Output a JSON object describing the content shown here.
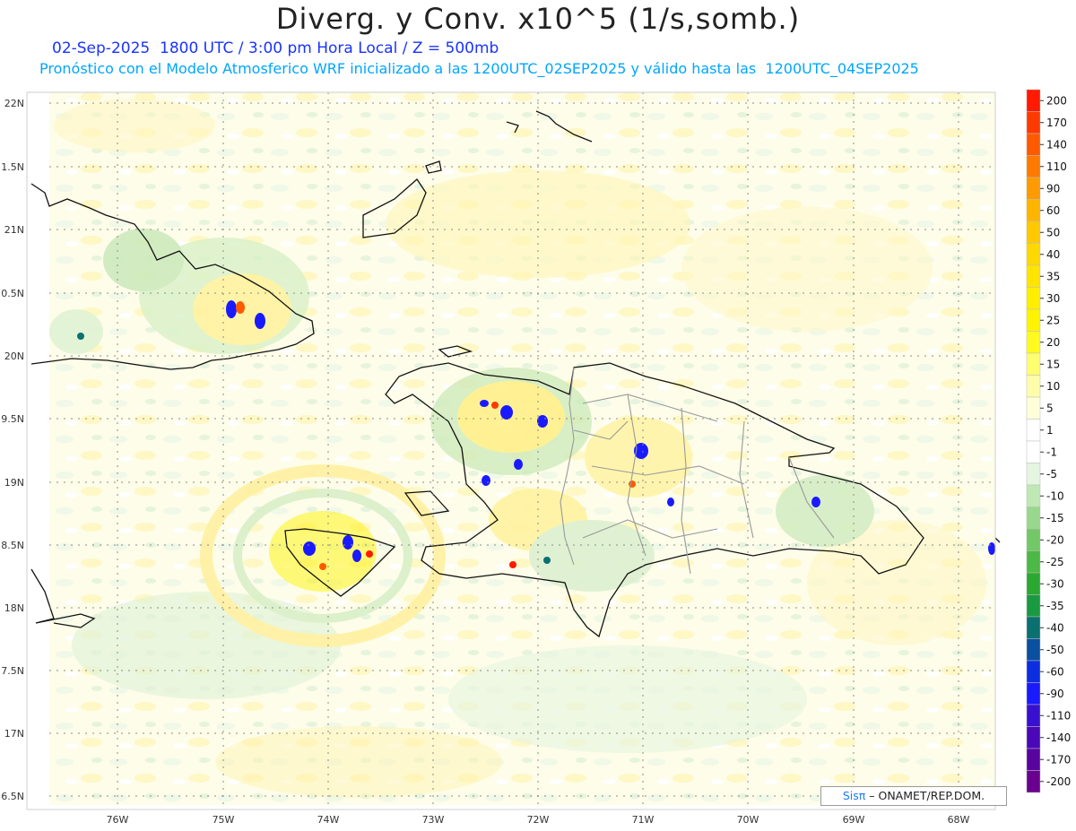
{
  "header": {
    "title": "Diverg. y Conv. x10^5 (1/s,somb.)",
    "subtitle_line1": "02-Sep-2025  1800 UTC / 3:00 pm Hora Local / Z = 500mb",
    "subtitle_line2": "Pronóstico con el Modelo Atmosferico WRF inicializado a las 1200UTC_02SEP2025 y válido hasta las  1200UTC_04SEP2025"
  },
  "axes": {
    "lat_labels": [
      "22N",
      "1.5N",
      "21N",
      "0.5N",
      "20N",
      "9.5N",
      "19N",
      "8.5N",
      "18N",
      "7.5N",
      "17N",
      "6.5N"
    ],
    "lon_labels": [
      "76W",
      "75W",
      "74W",
      "73W",
      "72W",
      "71W",
      "70W",
      "69W",
      "68W"
    ]
  },
  "legend": {
    "levels": [
      "200",
      "170",
      "140",
      "110",
      "90",
      "60",
      "50",
      "40",
      "35",
      "30",
      "25",
      "20",
      "15",
      "10",
      "5",
      "1",
      "-1",
      "-5",
      "-10",
      "-15",
      "-20",
      "-25",
      "-30",
      "-35",
      "-40",
      "-50",
      "-60",
      "-90",
      "-110",
      "-140",
      "-170",
      "-200"
    ],
    "colors": [
      "#ff1a00",
      "#ff3a00",
      "#ff5a00",
      "#ff7a00",
      "#ff9a00",
      "#ffb400",
      "#ffc800",
      "#ffd800",
      "#ffe400",
      "#ffee00",
      "#fff400",
      "#fffa20",
      "#fffd70",
      "#fffdaa",
      "#fffed8",
      "#ffffff",
      "#ffffff",
      "#e4f5e0",
      "#bfe8b4",
      "#98d88c",
      "#72c866",
      "#4cb845",
      "#2aa830",
      "#1a9a40",
      "#0a7070",
      "#0a4fa0",
      "#0a2ee0",
      "#1a1aff",
      "#3a10d0",
      "#4a08b8",
      "#5a04a0",
      "#6a0090"
    ]
  },
  "credit": {
    "sis": "Sisπ",
    "rest": " – ONAMET/REP.DOM."
  }
}
